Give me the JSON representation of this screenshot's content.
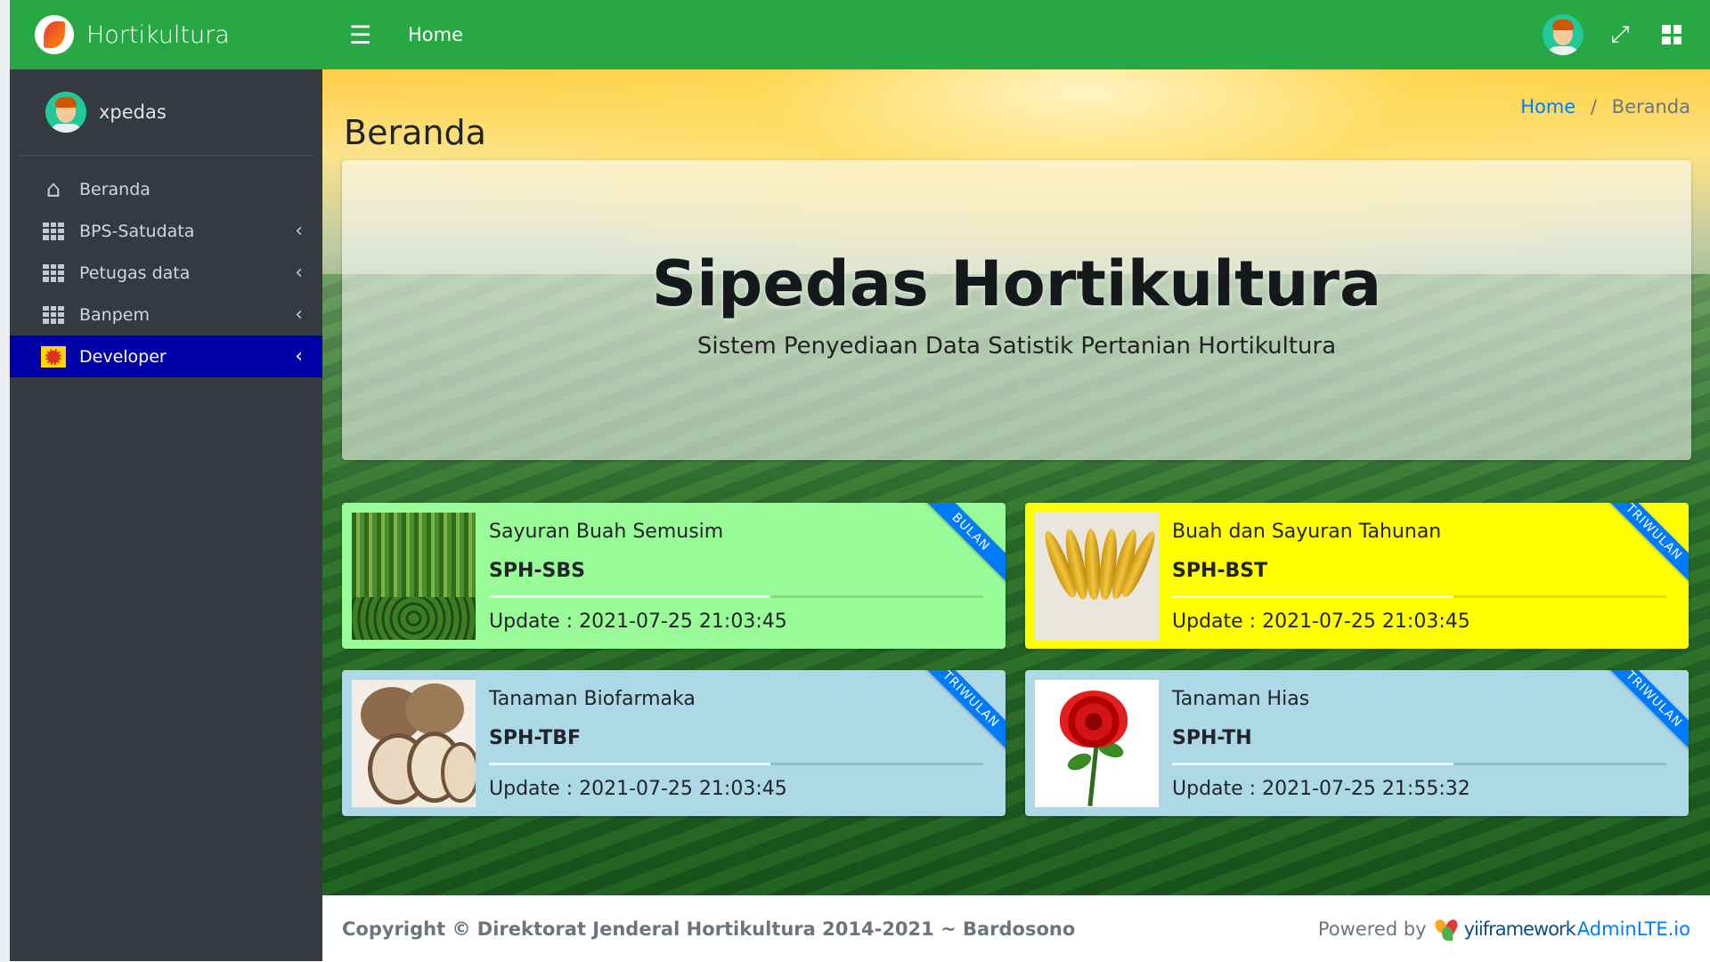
{
  "brand": {
    "name": "Hortikultura"
  },
  "user": {
    "name": "xpedas"
  },
  "sidebar": {
    "items": [
      {
        "label": "Beranda",
        "icon": "home-icon",
        "has_chevron": false,
        "active": false
      },
      {
        "label": "BPS-Satudata",
        "icon": "grid-icon",
        "has_chevron": true,
        "active": false
      },
      {
        "label": "Petugas data",
        "icon": "grid-icon",
        "has_chevron": true,
        "active": false
      },
      {
        "label": "Banpem",
        "icon": "grid-icon",
        "has_chevron": true,
        "active": false
      },
      {
        "label": "Developer",
        "icon": "developer-icon",
        "has_chevron": true,
        "active": true
      }
    ]
  },
  "topbar": {
    "home_label": "Home",
    "menu_icon": "hamburger-icon",
    "right_icons": [
      "user-avatar-icon",
      "fullscreen-icon",
      "apps-grid-icon"
    ]
  },
  "page": {
    "title": "Beranda"
  },
  "breadcrumb": {
    "home": "Home",
    "separator": "/",
    "current": "Beranda"
  },
  "hero": {
    "title": "Sipedas Hortikultura",
    "subtitle": "Sistem Penyediaan Data Satistik Pertanian Hortikultura"
  },
  "cards": [
    {
      "name": "Sayuran Buah Semusim",
      "code": "SPH-SBS",
      "update": "Update : 2021-07-25 21:03:45",
      "ribbon": "BULAN",
      "progress": 0.57,
      "bg": "#98fb98",
      "image": "long-beans-image"
    },
    {
      "name": "Buah dan Sayuran Tahunan",
      "code": "SPH-BST",
      "update": "Update : 2021-07-25 21:03:45",
      "ribbon": "TRIWULAN",
      "progress": 0.57,
      "bg": "#ffff00",
      "image": "banana-image"
    },
    {
      "name": "Tanaman Biofarmaka",
      "code": "SPH-TBF",
      "update": "Update : 2021-07-25 21:03:45",
      "ribbon": "TRIWULAN",
      "progress": 0.57,
      "bg": "#add8e6",
      "image": "taro-image"
    },
    {
      "name": "Tanaman Hias",
      "code": "SPH-TH",
      "update": "Update : 2021-07-25 21:55:32",
      "ribbon": "TRIWULAN",
      "progress": 0.57,
      "bg": "#add8e6",
      "image": "rose-image"
    }
  ],
  "footer": {
    "copyright": "Copyright © Direktorat Jenderal Hortikultura 2014-2021 ~ Bardosono",
    "powered_by": "Powered by",
    "yii": "yiiframework",
    "adminlte": "AdminLTE.io"
  },
  "colors": {
    "brand_green": "#28a745",
    "sidebar_bg": "#343a40",
    "active_item": "#0000a8",
    "ribbon_blue": "#007bff"
  }
}
